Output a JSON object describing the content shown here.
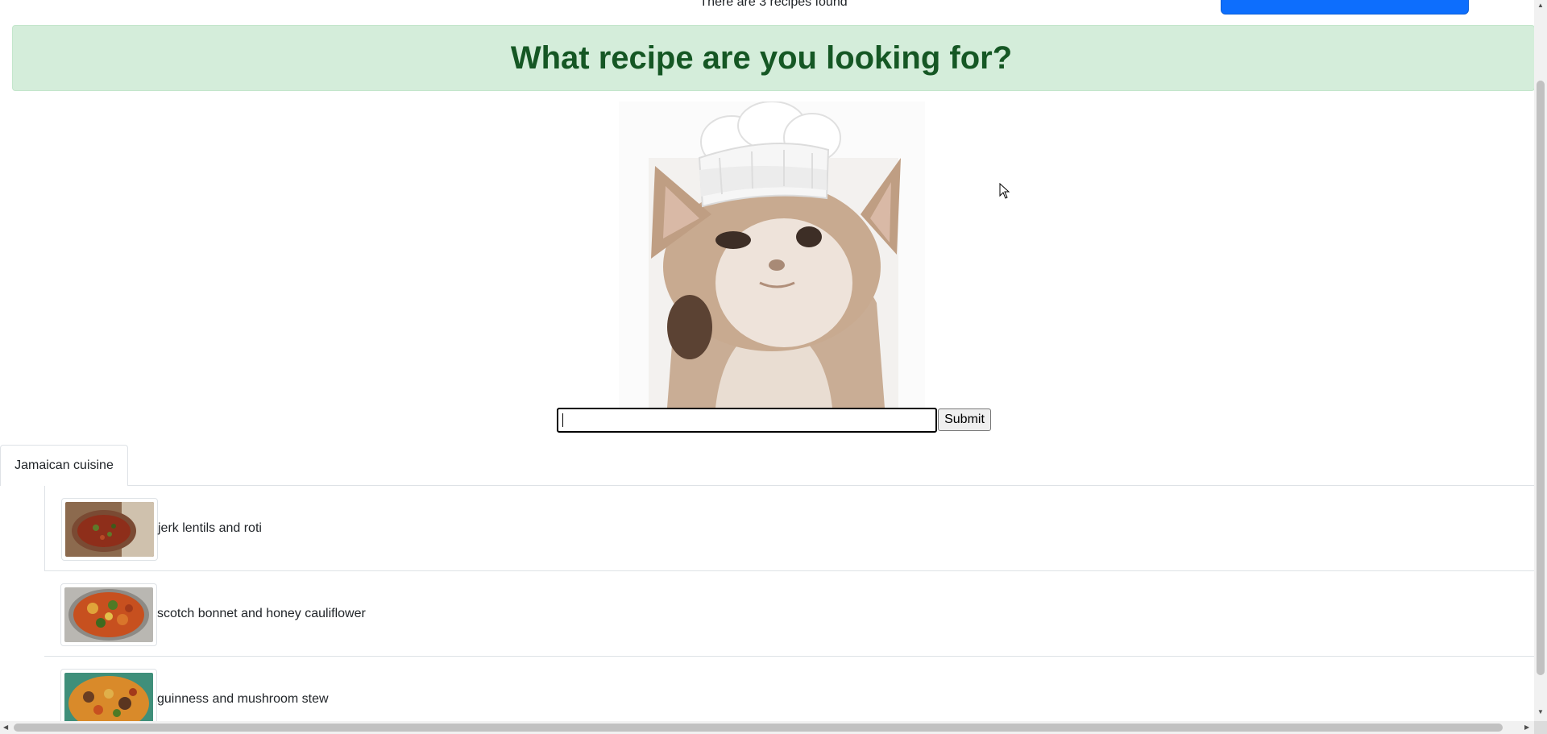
{
  "header": {
    "found_text": "There are 3 recipes found"
  },
  "banner": {
    "title": "What recipe are you looking for?",
    "background": "#d4edda",
    "text_color": "#155724"
  },
  "hero": {
    "image": "chef-cat-image",
    "alt": "cat wearing a chef hat"
  },
  "search": {
    "value": "",
    "placeholder": "",
    "submit_label": "Submit"
  },
  "tabs": [
    {
      "label": "Jamaican cuisine"
    }
  ],
  "recipes": [
    {
      "name": "jerk lentils and roti",
      "thumbnail": "lentil-stew-thumbnail"
    },
    {
      "name": "scotch bonnet and honey cauliflower",
      "thumbnail": "roasted-cauliflower-thumbnail"
    },
    {
      "name": "guinness and mushroom stew",
      "thumbnail": "mushroom-stew-thumbnail"
    }
  ],
  "colors": {
    "primary_button": "#0d6efd",
    "border": "#dee2e6"
  }
}
